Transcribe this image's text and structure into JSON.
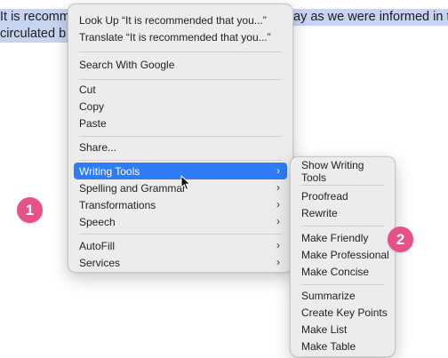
{
  "document": {
    "line1_left": "It is recomm",
    "line1_right": "ay as we were informed in th",
    "line2_left": "circulated b"
  },
  "context_menu": {
    "look_up": "Look Up “It is recommended that you...”",
    "translate": "Translate “It is recommended that you...”",
    "search_google": "Search With Google",
    "cut": "Cut",
    "copy": "Copy",
    "paste": "Paste",
    "share": "Share...",
    "writing_tools": "Writing Tools",
    "spelling_grammar": "Spelling and Grammar",
    "transformations": "Transformations",
    "speech": "Speech",
    "autofill": "AutoFill",
    "services": "Services"
  },
  "submenu": {
    "show_writing_tools": "Show Writing Tools",
    "proofread": "Proofread",
    "rewrite": "Rewrite",
    "make_friendly": "Make Friendly",
    "make_professional": "Make Professional",
    "make_concise": "Make Concise",
    "summarize": "Summarize",
    "create_key_points": "Create Key Points",
    "make_list": "Make List",
    "make_table": "Make Table"
  },
  "badges": {
    "one": "1",
    "two": "2"
  },
  "icons": {
    "chevron": "chevron-right-icon",
    "cursor": "mouse-pointer-icon"
  },
  "colors": {
    "highlight": "#2f7cf6",
    "badge": "#e8508a",
    "selection": "#c6d4ef"
  }
}
